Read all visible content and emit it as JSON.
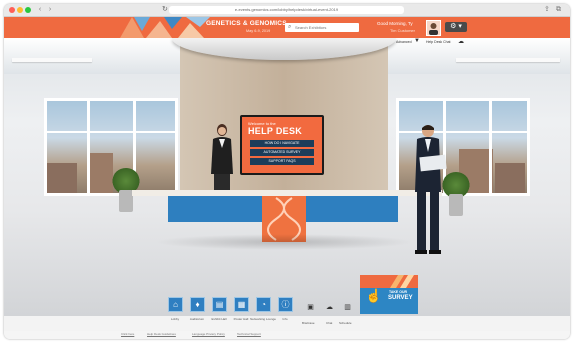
{
  "browser": {
    "url": "e-events.genomics.com/lobby/helpdesk/virtual-event-2019",
    "back_glyph": "‹",
    "forward_glyph": "›",
    "reload_glyph": "↻",
    "share_glyph": "⇪",
    "tabs_glyph": "⧉"
  },
  "header": {
    "title": "GENETICS & GENOMICS",
    "dates": "May 6-9, 2019",
    "search_placeholder": "Search Exhibitors",
    "greeting": "Good Morning, Ty",
    "user_name": "Tim Customer",
    "menu_glyph": "⚙ ▾",
    "accent": "#ef6a40"
  },
  "toolbar": {
    "filter_label": "Advanced",
    "filter_glyph": "▼",
    "message_label": "Help Desk Chat",
    "message_glyph": "☁"
  },
  "helpdesk": {
    "welcome": "Welcome to the",
    "title": "HELP DESK",
    "buttons": [
      "HOW DO I NAVIGATE",
      "AUTOMATED SURVEY",
      "SUPPORT FAQS"
    ]
  },
  "survey": {
    "take": "TAKE OUR",
    "label": "SURVEY",
    "icon_glyph": "☝"
  },
  "nav": {
    "items": [
      {
        "label": "Lobby",
        "glyph": "⌂"
      },
      {
        "label": "Auditorium",
        "glyph": "♦"
      },
      {
        "label": "Exhibit Hall",
        "glyph": "▤"
      },
      {
        "label": "Poster Hall",
        "glyph": "▦"
      },
      {
        "label": "Networking Lounge",
        "glyph": "◔"
      },
      {
        "label": "Info",
        "glyph": "ⓘ"
      }
    ],
    "tools": [
      {
        "label": "Briefcase",
        "glyph": "▣"
      },
      {
        "label": "Chat",
        "glyph": "☁"
      },
      {
        "label": "Schedule",
        "glyph": "▥"
      }
    ]
  },
  "footer": {
    "links": [
      "Click here",
      "Help Desk Guidelines",
      "Language Privacy Policy",
      "Technical Support"
    ]
  }
}
